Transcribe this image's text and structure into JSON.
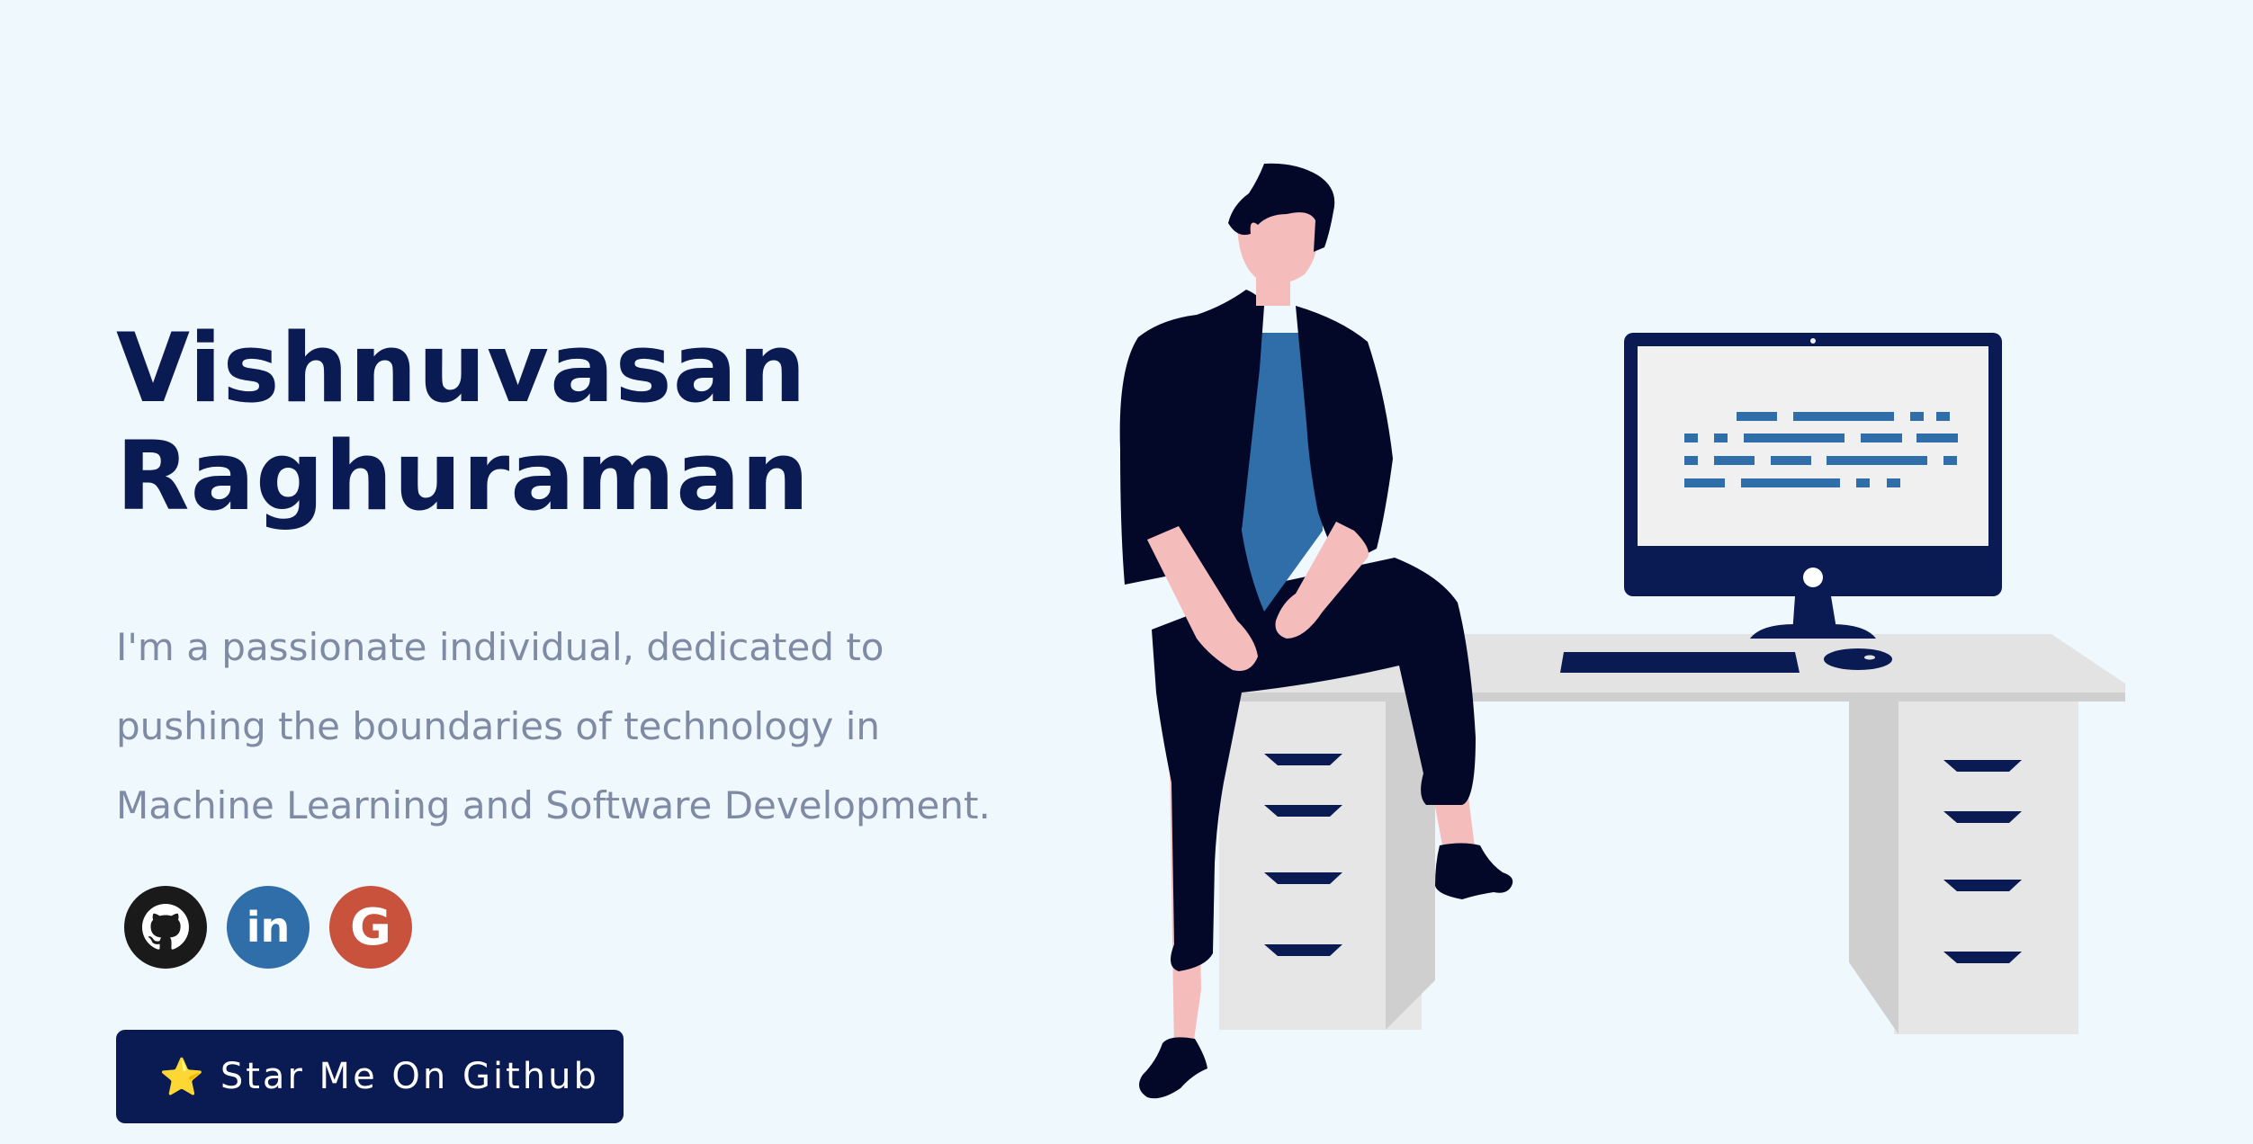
{
  "hero": {
    "name_line1": "Vishnuvasan",
    "name_line2": "Raghuraman",
    "bio": "I'm a passionate individual, dedicated to pushing the boundaries of technology in Machine Learning and Software Development."
  },
  "socials": [
    {
      "name": "GitHub",
      "icon": "github-icon",
      "color": "#1a1a1a"
    },
    {
      "name": "LinkedIn",
      "icon": "linkedin-icon",
      "label": "in",
      "color": "#2f6ea9"
    },
    {
      "name": "Google",
      "icon": "google-icon",
      "label": "G",
      "color": "#c9523d"
    }
  ],
  "cta": {
    "icon": "star-icon",
    "star_glyph": "⭐",
    "label": "Star Me On Github"
  },
  "colors": {
    "background": "#eff8fd",
    "primary": "#0a1a52",
    "bio_text": "#7f8ba4",
    "illustration_blue": "#2f6ea9"
  }
}
